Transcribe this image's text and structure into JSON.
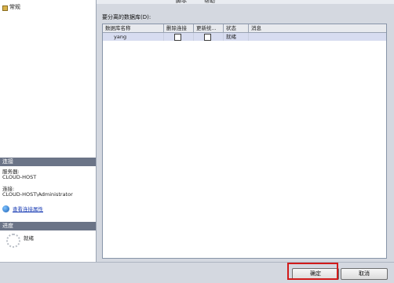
{
  "toolbar": {
    "script_label": "脚本",
    "help_label": "帮助"
  },
  "nav": {
    "item_label": "常规"
  },
  "connection_section": {
    "header": "连接",
    "server_label": "服务器:",
    "server_value": "CLOUD-HOST",
    "connection_label": "连接:",
    "connection_value": "CLOUD-HOST\\Administrator",
    "link_text": "查看连接属性"
  },
  "progress_section": {
    "header": "进度",
    "status": "就绪"
  },
  "grid": {
    "title": "要分离的数据库(D):",
    "columns": [
      "数据库名称",
      "删除连接",
      "更新统...",
      "状态",
      "消息"
    ],
    "rows": [
      {
        "name": "yang",
        "drop_connections": false,
        "update_statistics": false,
        "status": "就绪",
        "message": ""
      }
    ]
  },
  "buttons": {
    "ok": "确定",
    "cancel": "取消"
  }
}
